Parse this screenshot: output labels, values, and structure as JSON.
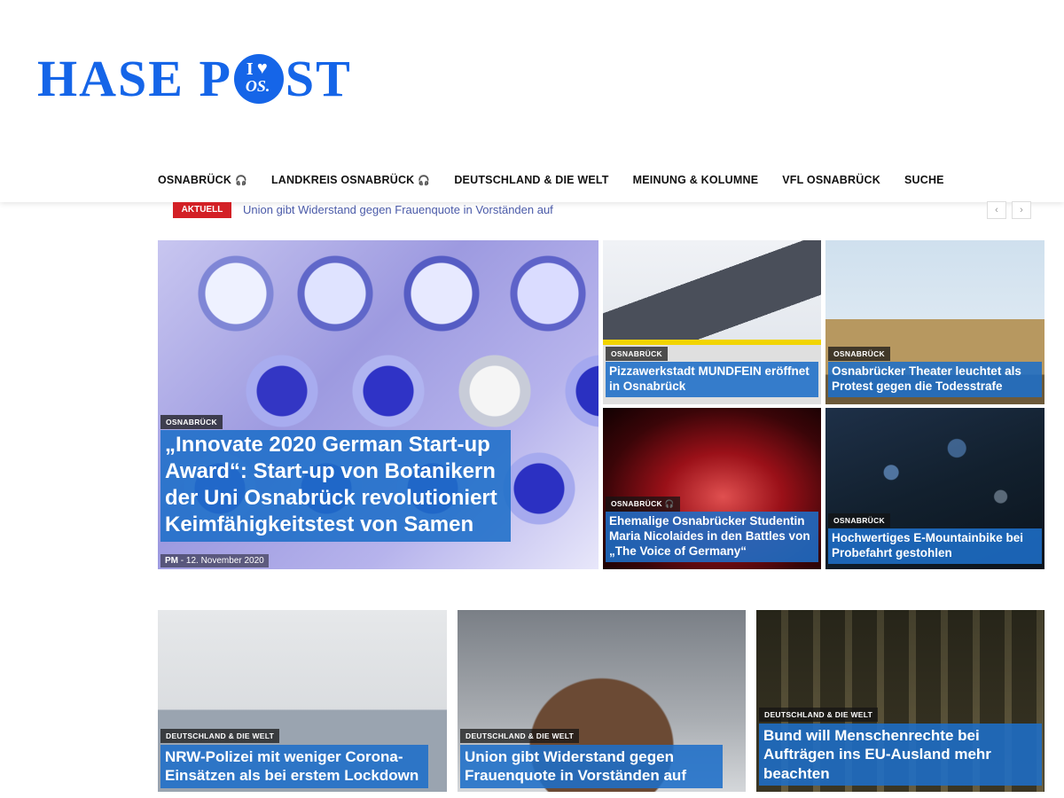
{
  "logo": {
    "left": "HASE P",
    "right": "ST",
    "emblem_i": "I",
    "emblem_heart": "♥",
    "emblem_os": "OS."
  },
  "nav": {
    "items": [
      {
        "label": "OSNABRÜCK",
        "podcast": "🎧"
      },
      {
        "label": "LANDKREIS OSNABRÜCK",
        "podcast": "🎧"
      },
      {
        "label": "DEUTSCHLAND & DIE WELT",
        "podcast": ""
      },
      {
        "label": "MEINUNG & KOLUMNE",
        "podcast": ""
      },
      {
        "label": "VFL OSNABRÜCK",
        "podcast": ""
      },
      {
        "label": "SUCHE",
        "podcast": ""
      }
    ]
  },
  "ticker": {
    "badge": "AKTUELL",
    "text": "Union gibt Widerstand gegen Frauenquote in Vorständen auf",
    "prev": "‹",
    "next": "›"
  },
  "featured": {
    "category": "OSNABRÜCK",
    "title": "„Innovate 2020 German Start-up Award“: Start-up von Botanikern der Uni Osnabrück revolutioniert Keimfähigkeitstest von Samen",
    "author": "PM",
    "sep": "-",
    "date": "12. November 2020"
  },
  "tiles": [
    {
      "category": "OSNABRÜCK",
      "title": "Pizzawerkstadt MUNDFEIN eröffnet in Osnabrück"
    },
    {
      "category": "OSNABRÜCK",
      "title": "Osnabrücker Theater leuchtet als Protest gegen die Todesstrafe"
    },
    {
      "category": "OSNABRÜCK 🎧",
      "title": "Ehemalige Osnabrücker Studentin Maria Nicolaides in den Battles von „The Voice of Germany“"
    },
    {
      "category": "OSNABRÜCK",
      "title": "Hochwertiges E-Mountainbike bei Probefahrt gestohlen"
    }
  ],
  "bottom": [
    {
      "category": "DEUTSCHLAND & DIE WELT",
      "title": "NRW-Polizei mit weniger Corona-Einsätzen als bei erstem Lockdown"
    },
    {
      "category": "DEUTSCHLAND & DIE WELT",
      "title": "Union gibt Widerstand gegen Frauenquote in Vorständen auf"
    },
    {
      "category": "DEUTSCHLAND & DIE WELT",
      "title": "Bund will Menschenrechte bei Aufträgen ins EU-Ausland mehr beachten"
    }
  ],
  "colors": {
    "brand": "#1565e8",
    "ticker_badge": "#d32026",
    "title_overlay": "#1e6ec8"
  }
}
